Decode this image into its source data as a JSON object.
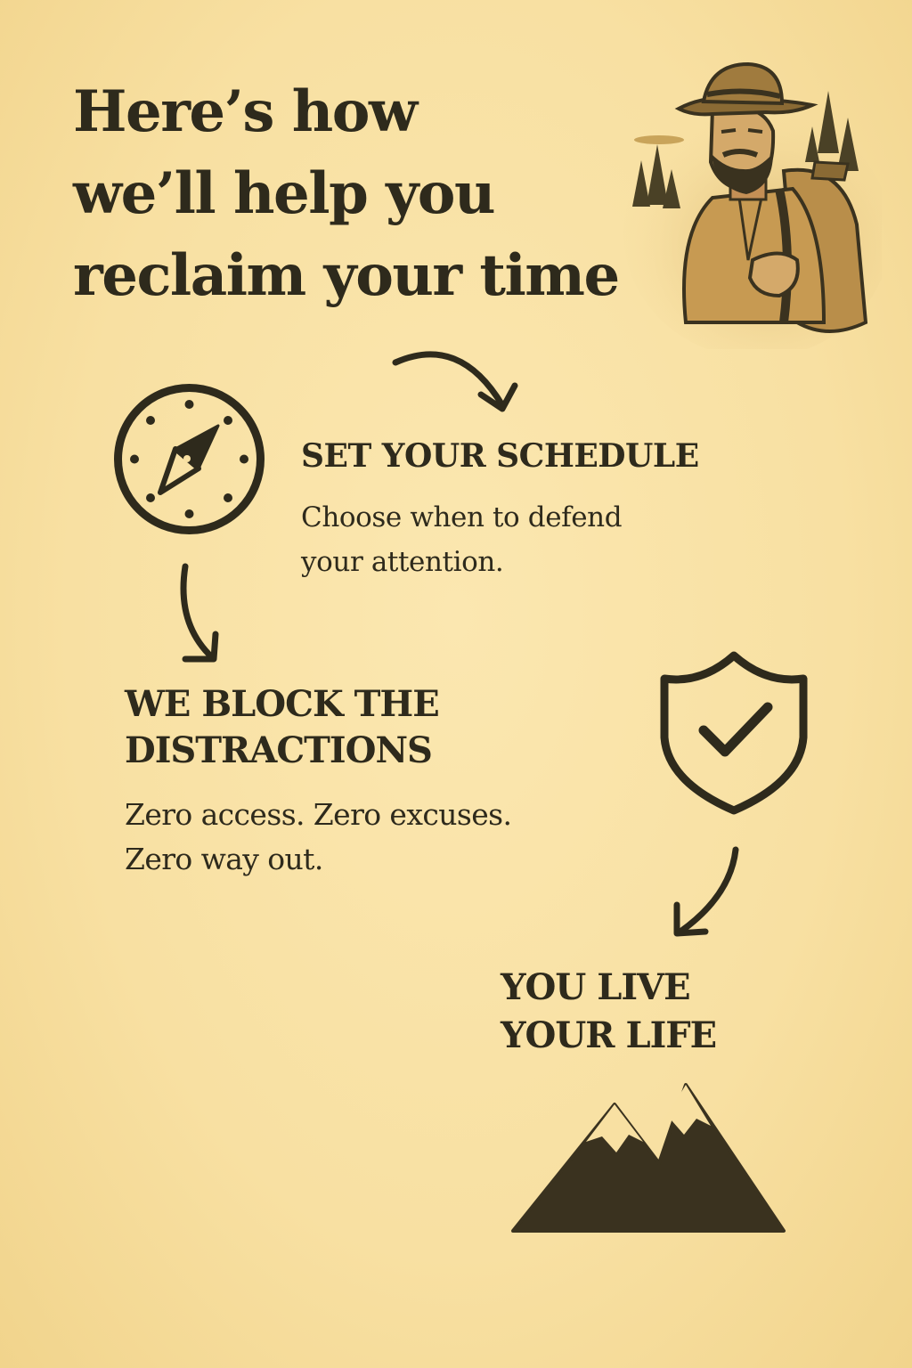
{
  "headline": {
    "lines": [
      "Here’s how",
      "we’ll help you",
      "reclaim your time"
    ]
  },
  "steps": [
    {
      "icon": "compass-icon",
      "title_lines": [
        "SET YOUR SCHEDULE"
      ],
      "description_lines": [
        "Choose when to defend",
        "your attention."
      ]
    },
    {
      "icon": "shield-check-icon",
      "title_lines": [
        "WE BLOCK THE",
        "DISTRACTIONS"
      ],
      "description_lines": [
        "Zero access. Zero excuses.",
        "Zero way out."
      ]
    },
    {
      "icon": "mountains-icon",
      "title_lines": [
        "YOU LIVE",
        "YOUR LIFE"
      ],
      "description_lines": []
    }
  ],
  "colors": {
    "background": "#f8e0a2",
    "ink": "#2e2a1c",
    "accent": "#c9a45a"
  }
}
